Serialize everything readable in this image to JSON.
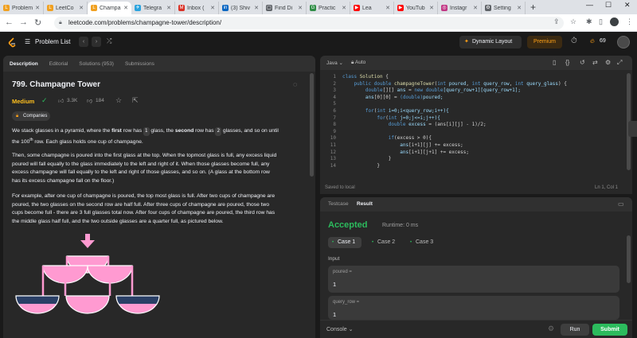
{
  "browser": {
    "tabs": [
      {
        "label": "Problem",
        "color": "#f0a020",
        "glyph": "L"
      },
      {
        "label": "LeetCo",
        "color": "#f0a020",
        "glyph": "L"
      },
      {
        "label": "Champa",
        "color": "#f0a020",
        "glyph": "L"
      },
      {
        "label": "Telegra",
        "color": "#2aa3de",
        "glyph": "✈"
      },
      {
        "label": "Inbox (",
        "color": "#d93025",
        "glyph": "M"
      },
      {
        "label": "(3) Shiv",
        "color": "#0a66c2",
        "glyph": "in"
      },
      {
        "label": "Find Di",
        "color": "#5f6368",
        "glyph": "▢"
      },
      {
        "label": "Practic",
        "color": "#2f8d46",
        "glyph": "G"
      },
      {
        "label": "Lea",
        "color": "#ff0000",
        "glyph": "▶"
      },
      {
        "label": "YouTub",
        "color": "#ff0000",
        "glyph": "▶"
      },
      {
        "label": "Instagr",
        "color": "#c13584",
        "glyph": "◎"
      },
      {
        "label": "Setting",
        "color": "#5f6368",
        "glyph": "⚙"
      }
    ],
    "new_tab": "+",
    "url": "leetcode.com/problems/champagne-tower/description/"
  },
  "nav": {
    "problem_list": "Problem List",
    "dynamic_layout": "Dynamic Layout",
    "premium": "Premium",
    "streak": "69"
  },
  "left": {
    "tabs": [
      "Description",
      "Editorial",
      "Solutions (953)",
      "Submissions"
    ],
    "title": "799. Champagne Tower",
    "difficulty": "Medium",
    "likes": "3.3K",
    "dislikes": "184",
    "companies": "Companies",
    "p1": {
      "a": "We stack glasses in a pyramid, where the ",
      "b": "first",
      "c": " row has ",
      "d": "1",
      "e": " glass, the ",
      "f": "second",
      "g": " row has ",
      "h": "2",
      "i": " glasses, and so on until",
      "j": "the 100",
      "k": "th",
      "l": " row.  Each glass holds one cup of champagne."
    },
    "p2": [
      "Then, some champagne is poured into the first glass at the top.  When the topmost glass is full, any excess liquid",
      "poured will fall equally to the glass immediately to the left and right of it.  When those glasses become full, any",
      "excess champagne will fall equally to the left and right of those glasses, and so on.  (A glass at the bottom row",
      "has its excess champagne fall on the floor.)"
    ],
    "p3": [
      "For example, after one cup of champagne is poured, the top most glass is full.  After two cups of champagne are",
      "poured, the two glasses on the second row are half full.  After three cups of champagne are poured, those two",
      "cups become full - there are 3 full glasses total now.  After four cups of champagne are poured, the third row has",
      "the middle glass half full, and the two outside glasses are a quarter full, as pictured below."
    ]
  },
  "editor": {
    "language": "Java",
    "mode": "Auto",
    "saved": "Saved to local",
    "cursor": "Ln 1, Col 1",
    "line_numbers": [
      "1",
      "2",
      "3",
      "4",
      "5",
      "6",
      "7",
      "8",
      "9",
      "10",
      "11",
      "12",
      "13",
      "14"
    ],
    "lines": [
      [
        {
          "t": "class ",
          "c": "kw"
        },
        {
          "t": "Solution ",
          "c": "fn"
        },
        {
          "t": "{",
          "c": "op"
        }
      ],
      [
        {
          "t": "    public ",
          "c": "kw"
        },
        {
          "t": "double ",
          "c": "kw"
        },
        {
          "t": "champagneTower",
          "c": "fn"
        },
        {
          "t": "(",
          "c": "op"
        },
        {
          "t": "int ",
          "c": "kw"
        },
        {
          "t": "poured",
          "c": "var"
        },
        {
          "t": ", ",
          "c": "op"
        },
        {
          "t": "int ",
          "c": "kw"
        },
        {
          "t": "query_row",
          "c": "var"
        },
        {
          "t": ", ",
          "c": "op"
        },
        {
          "t": "int ",
          "c": "kw"
        },
        {
          "t": "query_glass",
          "c": "var"
        },
        {
          "t": ") {",
          "c": "op"
        }
      ],
      [
        {
          "t": "        double",
          "c": "kw"
        },
        {
          "t": "[][] ",
          "c": "op"
        },
        {
          "t": "ans",
          "c": "var"
        },
        {
          "t": " = ",
          "c": "op"
        },
        {
          "t": "new ",
          "c": "kw"
        },
        {
          "t": "double",
          "c": "kw"
        },
        {
          "t": "[query_row+1][query_row+1];",
          "c": "var"
        }
      ],
      [
        {
          "t": "        ans",
          "c": "var"
        },
        {
          "t": "[0][0] = ",
          "c": "op"
        },
        {
          "t": "(double)",
          "c": "kw"
        },
        {
          "t": "poured;",
          "c": "var"
        }
      ],
      [
        {
          "t": "",
          "c": "op"
        }
      ],
      [
        {
          "t": "        for",
          "c": "kw"
        },
        {
          "t": "(",
          "c": "op"
        },
        {
          "t": "int ",
          "c": "kw"
        },
        {
          "t": "i=0;i<query_row;i++){",
          "c": "var"
        }
      ],
      [
        {
          "t": "            for",
          "c": "kw"
        },
        {
          "t": "(",
          "c": "op"
        },
        {
          "t": "int ",
          "c": "kw"
        },
        {
          "t": "j=0;j<=i;j++){",
          "c": "var"
        }
      ],
      [
        {
          "t": "                double ",
          "c": "kw"
        },
        {
          "t": "excess",
          "c": "var"
        },
        {
          "t": " = (ans[i][j] - 1)/2;",
          "c": "op"
        }
      ],
      [
        {
          "t": "",
          "c": "op"
        }
      ],
      [
        {
          "t": "                if",
          "c": "kw"
        },
        {
          "t": "(excess > 0){",
          "c": "op"
        }
      ],
      [
        {
          "t": "                    ans",
          "c": "var"
        },
        {
          "t": "[i+1][j] += excess;",
          "c": "op"
        }
      ],
      [
        {
          "t": "                    ans",
          "c": "var"
        },
        {
          "t": "[i+1][j+1] += excess;",
          "c": "op"
        }
      ],
      [
        {
          "t": "                }",
          "c": "op"
        }
      ],
      [
        {
          "t": "            }",
          "c": "op"
        }
      ]
    ]
  },
  "result": {
    "tab_testcase": "Testcase",
    "tab_result": "Result",
    "status": "Accepted",
    "runtime": "Runtime: 0 ms",
    "cases": [
      "Case 1",
      "Case 2",
      "Case 3"
    ],
    "input_label": "Input",
    "poured_label": "poured =",
    "poured_value": "1",
    "query_row_label": "query_row =",
    "query_row_value": "1",
    "console": "Console",
    "run": "Run",
    "submit": "Submit"
  }
}
